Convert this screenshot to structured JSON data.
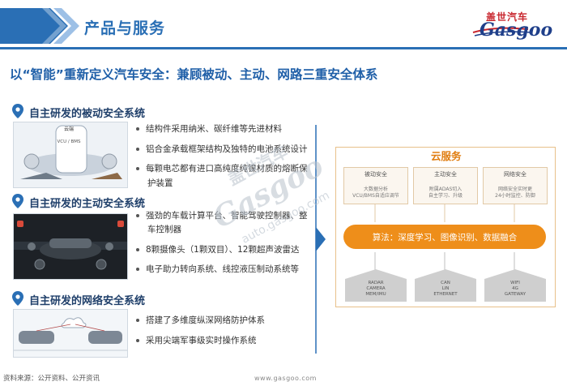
{
  "header": {
    "title": "产品与服务",
    "logo_cn": "盖世汽车",
    "logo_en": "Gasgoo"
  },
  "headline": "以“智能”重新定义汽车安全：兼顾被动、主动、网路三重安全体系",
  "sections": [
    {
      "title": "自主研发的被动安全系统",
      "thumb_labels": [
        "云端",
        "VCU / BMS"
      ],
      "bullets": [
        [
          "结构件采用纳米、碳纤维等先进材料"
        ],
        [
          "铝合金承载框架结构及独特的电池系统设计"
        ],
        [
          "每颗电芯都有进口高纯度纯镍材质的熔断保",
          "护装置"
        ]
      ]
    },
    {
      "title": "自主研发的主动安全系统",
      "bullets": [
        [
          "强劲的车载计算平台、智能驾驶控制器、整",
          "车控制器"
        ],
        [
          "8颗摄像头（1颗双目）、12颗超声波雷达"
        ],
        [
          "电子助力转向系统、线控液压制动系统等"
        ]
      ]
    },
    {
      "title": "自主研发的网络安全系统",
      "bullets": [
        [
          "搭建了多维度纵深网络防护体系"
        ],
        [
          "采用尖端军事级实时操作系统"
        ]
      ]
    }
  ],
  "diagram": {
    "title": "云服务",
    "boxes": [
      {
        "title": "被动安全",
        "lines": [
          "大数据分析",
          "VCU/BMS自适应调节"
        ]
      },
      {
        "title": "主动安全",
        "lines": [
          "附属ADAS切入",
          "自主学习、升级"
        ]
      },
      {
        "title": "网络安全",
        "lines": [
          "网络安全实时更",
          "24小时监控、防御"
        ]
      }
    ],
    "algorithm": "算法：深度学习、图像识别、数据融合",
    "houses": [
      {
        "lines": [
          "RADAR",
          "CAMERA",
          "MEM/IMU"
        ]
      },
      {
        "lines": [
          "CAN",
          "LIN",
          "ETHERNET"
        ]
      },
      {
        "lines": [
          "WIFI",
          "4G",
          "GATEWAY"
        ]
      }
    ]
  },
  "watermark": {
    "cn": "盖世汽车",
    "en": "Gasgoo",
    "url": "auto.gasgoo.com"
  },
  "footer": {
    "source": "资料来源：公开资料、公开资讯",
    "url": "www.gasgoo.com"
  },
  "colors": {
    "brand_blue": "#2a6fb5",
    "accent_orange": "#ee8e1a",
    "logo_red": "#c8262e"
  }
}
